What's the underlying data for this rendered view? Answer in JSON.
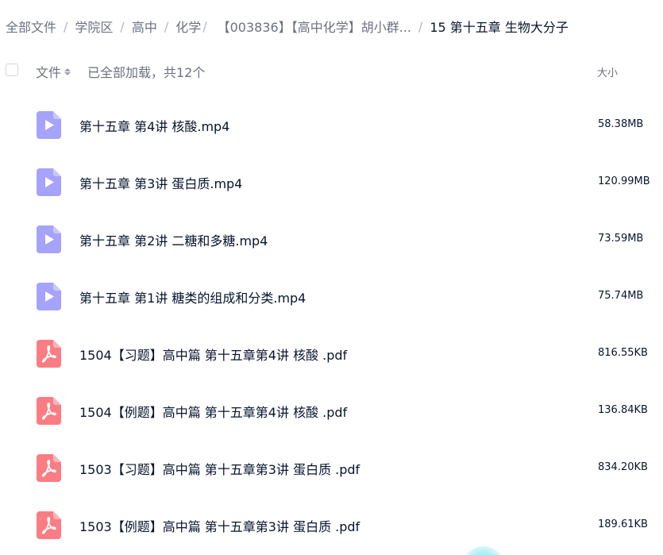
{
  "breadcrumb": {
    "items": [
      "全部文件",
      "学院区",
      "高中",
      "化学",
      "【003836】【高中化学】胡小群...",
      "15 第十五章 生物大分子"
    ],
    "separator": "/"
  },
  "header": {
    "name_col_label": "文件",
    "load_status": "已全部加载，共12个",
    "size_col_label": "大小"
  },
  "colors": {
    "video_icon": "#a5a3fb",
    "pdf_icon": "#fb7d84",
    "text_primary": "#06152d",
    "text_secondary": "#6b7280"
  },
  "files": [
    {
      "name": "第十五章 第4讲 核酸.mp4",
      "size": "58.38MB",
      "type": "video",
      "icon": "video-file-icon"
    },
    {
      "name": "第十五章 第3讲 蛋白质.mp4",
      "size": "120.99MB",
      "type": "video",
      "icon": "video-file-icon"
    },
    {
      "name": "第十五章 第2讲 二糖和多糖.mp4",
      "size": "73.59MB",
      "type": "video",
      "icon": "video-file-icon"
    },
    {
      "name": "第十五章 第1讲 糖类的组成和分类.mp4",
      "size": "75.74MB",
      "type": "video",
      "icon": "video-file-icon"
    },
    {
      "name": "1504【习题】高中篇 第十五章第4讲 核酸 .pdf",
      "size": "816.55KB",
      "type": "pdf",
      "icon": "pdf-file-icon"
    },
    {
      "name": "1504【例题】高中篇 第十五章第4讲 核酸 .pdf",
      "size": "136.84KB",
      "type": "pdf",
      "icon": "pdf-file-icon"
    },
    {
      "name": "1503【习题】高中篇 第十五章第3讲 蛋白质 .pdf",
      "size": "834.20KB",
      "type": "pdf",
      "icon": "pdf-file-icon"
    },
    {
      "name": "1503【例题】高中篇 第十五章第3讲 蛋白质 .pdf",
      "size": "189.61KB",
      "type": "pdf",
      "icon": "pdf-file-icon"
    }
  ]
}
